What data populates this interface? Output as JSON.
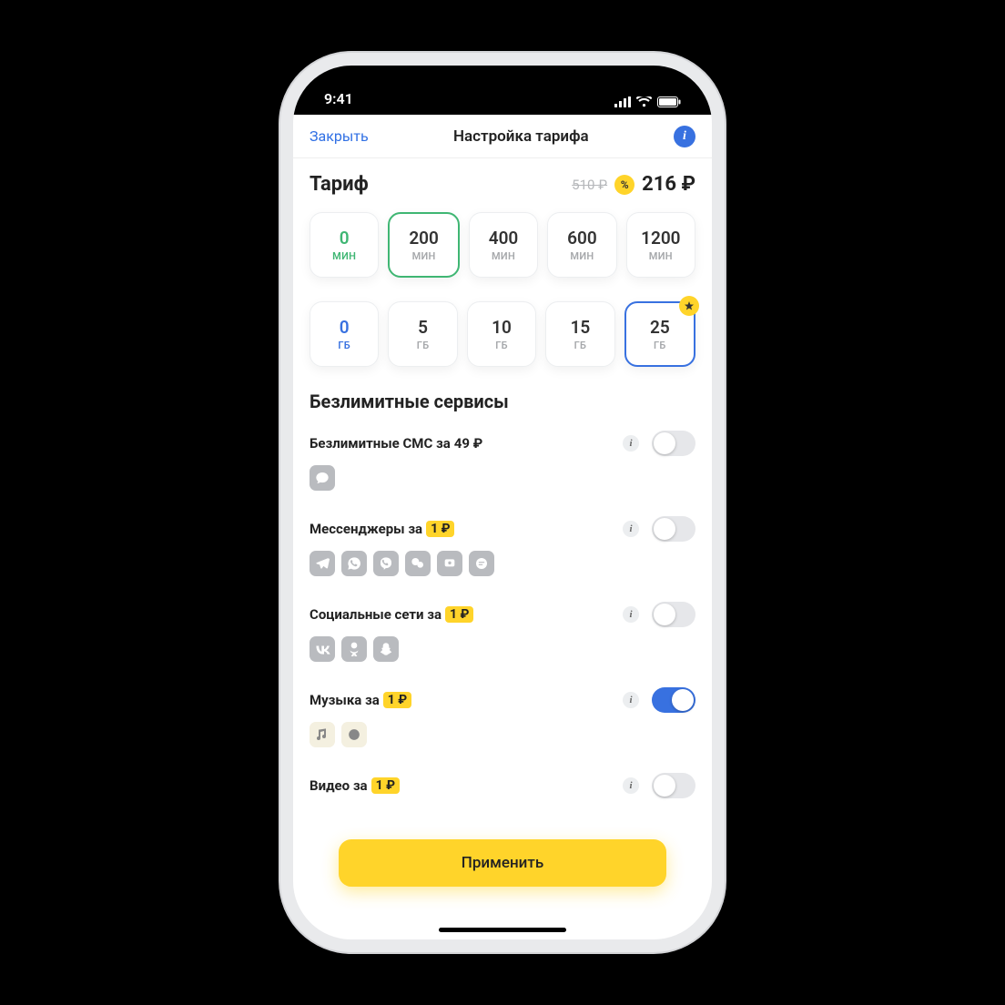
{
  "statusbar": {
    "time": "9:41"
  },
  "nav": {
    "close": "Закрыть",
    "title": "Настройка тарифа"
  },
  "tariff": {
    "title": "Тариф",
    "old_price": "510 ₽",
    "discount": "%",
    "new_price": "216 ₽"
  },
  "minutes": {
    "unit": "МИН",
    "options": [
      {
        "value": "0",
        "zero": true
      },
      {
        "value": "200",
        "selected": true
      },
      {
        "value": "400"
      },
      {
        "value": "600"
      },
      {
        "value": "1200"
      }
    ]
  },
  "gb": {
    "unit": "ГБ",
    "options": [
      {
        "value": "0",
        "zero": true
      },
      {
        "value": "5"
      },
      {
        "value": "10"
      },
      {
        "value": "15"
      },
      {
        "value": "25",
        "selected": true,
        "star": true
      }
    ]
  },
  "section_unlimited": "Безлимитные сервисы",
  "services": [
    {
      "id": "sms",
      "label_prefix": "Безлимитные СМС за ",
      "price": "49 ₽",
      "price_plain": true,
      "on": false,
      "icons": [
        "chat"
      ]
    },
    {
      "id": "messengers",
      "label_prefix": "Мессенджеры за ",
      "price": "1 ₽",
      "on": false,
      "icons": [
        "telegram",
        "whatsapp",
        "viber",
        "wechat",
        "kakao",
        "line"
      ]
    },
    {
      "id": "social",
      "label_prefix": "Социальные сети за ",
      "price": "1 ₽",
      "on": false,
      "icons": [
        "vk",
        "ok",
        "snap"
      ]
    },
    {
      "id": "music",
      "label_prefix": "Музыка за ",
      "price": "1 ₽",
      "on": true,
      "icons": [
        "music",
        "spot"
      ],
      "light_icons": true
    },
    {
      "id": "video",
      "label_prefix": "Видео за ",
      "price": "1 ₽",
      "on": false,
      "icons": []
    }
  ],
  "apply": "Применить"
}
